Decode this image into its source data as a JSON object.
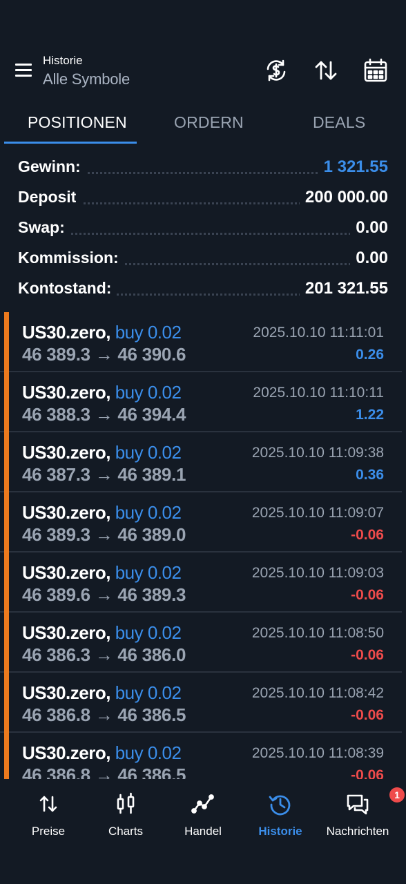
{
  "header": {
    "subtitle": "Historie",
    "title": "Alle Symbole",
    "icons": [
      "currency-exchange-icon",
      "sort-icon",
      "calendar-icon"
    ]
  },
  "tabs": [
    {
      "label": "POSITIONEN",
      "active": true
    },
    {
      "label": "ORDERN",
      "active": false
    },
    {
      "label": "DEALS",
      "active": false
    }
  ],
  "summary": {
    "gewinn": {
      "label": "Gewinn:",
      "value": "1 321.55"
    },
    "deposit": {
      "label": "Deposit",
      "value": "200 000.00"
    },
    "swap": {
      "label": "Swap:",
      "value": "0.00"
    },
    "kommission": {
      "label": "Kommission:",
      "value": "0.00"
    },
    "kontostand": {
      "label": "Kontostand:",
      "value": "201 321.55"
    }
  },
  "positions": [
    {
      "symbol": "US30.zero,",
      "side": "buy 0.02",
      "prices": "46 389.3 → 46 390.6",
      "time": "2025.10.10 11:11:01",
      "profit": "0.26",
      "sign": "pos"
    },
    {
      "symbol": "US30.zero,",
      "side": "buy 0.02",
      "prices": "46 388.3 → 46 394.4",
      "time": "2025.10.10 11:10:11",
      "profit": "1.22",
      "sign": "pos"
    },
    {
      "symbol": "US30.zero,",
      "side": "buy 0.02",
      "prices": "46 387.3 → 46 389.1",
      "time": "2025.10.10 11:09:38",
      "profit": "0.36",
      "sign": "pos"
    },
    {
      "symbol": "US30.zero,",
      "side": "buy 0.02",
      "prices": "46 389.3 → 46 389.0",
      "time": "2025.10.10 11:09:07",
      "profit": "-0.06",
      "sign": "neg"
    },
    {
      "symbol": "US30.zero,",
      "side": "buy 0.02",
      "prices": "46 389.6 → 46 389.3",
      "time": "2025.10.10 11:09:03",
      "profit": "-0.06",
      "sign": "neg"
    },
    {
      "symbol": "US30.zero,",
      "side": "buy 0.02",
      "prices": "46 386.3 → 46 386.0",
      "time": "2025.10.10 11:08:50",
      "profit": "-0.06",
      "sign": "neg"
    },
    {
      "symbol": "US30.zero,",
      "side": "buy 0.02",
      "prices": "46 386.8 → 46 386.5",
      "time": "2025.10.10 11:08:42",
      "profit": "-0.06",
      "sign": "neg"
    },
    {
      "symbol": "US30.zero,",
      "side": "buy 0.02",
      "prices": "46 386.8 → 46 386.5",
      "time": "2025.10.10 11:08:39",
      "profit": "-0.06",
      "sign": "neg"
    }
  ],
  "nav": [
    {
      "label": "Preise",
      "icon": "arrows-updown-icon"
    },
    {
      "label": "Charts",
      "icon": "candlestick-icon"
    },
    {
      "label": "Handel",
      "icon": "trend-line-icon"
    },
    {
      "label": "Historie",
      "icon": "history-icon",
      "active": true
    },
    {
      "label": "Nachrichten",
      "icon": "chat-icon",
      "badge": "1"
    }
  ],
  "colors": {
    "background": "#131a24",
    "accent": "#3b8eea",
    "negative": "#ef4b4b",
    "buy_bar": "#ec7a1e"
  }
}
